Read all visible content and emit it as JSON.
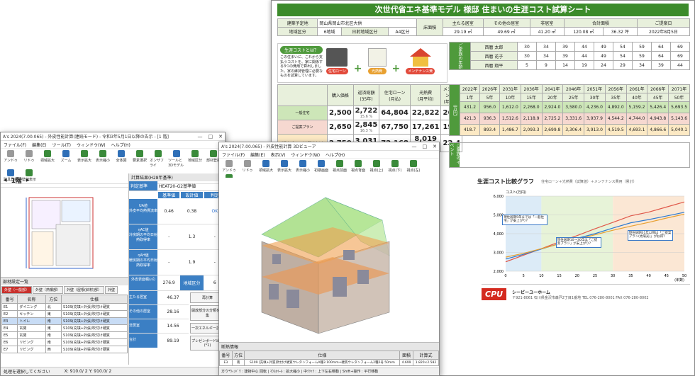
{
  "sheet": {
    "title": "次世代省エネ基準モデル 様邸 住まいの生涯コスト試算シート",
    "info": {
      "site_label": "建築予定地",
      "site": "岡山県岡山市北区大供",
      "region_label": "地域区分",
      "region": "6地域",
      "solar_label": "日射地域区分",
      "solar": "A4区分",
      "floor_label": "床面積",
      "main_label": "主たる居室",
      "main_val": "29.19 ㎡",
      "other_label": "その他の居室",
      "other_val": "49.69 ㎡",
      "nonlive_label": "非居室",
      "nonlive_val": "41.20 ㎡",
      "total_label": "合計面積",
      "total_val": "120.08 ㎡",
      "tsubo_val": "36.32 坪",
      "date_label": "ご提案日",
      "date": "2022年8月5日"
    },
    "what_title": "生涯コストとは？",
    "what_text": "この住まいに、これから支払うコストを、家に関係する3つの費用で算出しました。家の維持管理に必要なものを試算しています。",
    "cost_icons": [
      "住宅ローン",
      "光熱費",
      "メンテナンス費"
    ],
    "family_header": "ご家族の年齢",
    "family": [
      {
        "name": "西暦 太郎",
        "ages": [
          "30",
          "34",
          "39",
          "44",
          "49",
          "54",
          "59",
          "64",
          "69"
        ]
      },
      {
        "name": "西暦 花子",
        "ages": [
          "30",
          "34",
          "39",
          "44",
          "49",
          "54",
          "59",
          "64",
          "69"
        ]
      },
      {
        "name": "西暦 翔平",
        "ages": [
          "5",
          "9",
          "14",
          "19",
          "24",
          "29",
          "34",
          "39",
          "44"
        ]
      }
    ],
    "cost_headers": [
      "購入価格",
      "返済総額\n(35年)",
      "住宅ローン\n(月払)",
      "光熱費\n(月平均)",
      "メンテナンス費\n(年平均)"
    ],
    "rows": [
      {
        "name": "一般住宅",
        "price": "2,500",
        "repay": "2,722",
        "loan": "64,804",
        "energy": "22,822",
        "maint": "26.0",
        "ratio": "15.6 %"
      },
      {
        "name": "ご提案プラン",
        "price": "2,650",
        "repay": "2,845",
        "loan": "67,750",
        "energy": "17,261",
        "maint": "19.2",
        "ratio": "16.3 %"
      },
      {
        "name": "ご提案プラン（太陽光含む）",
        "price": "2,750",
        "repay": "3,031",
        "loan": "72,168",
        "energy": "8,019",
        "energy2": "10,216",
        "maint": "22.4",
        "ratio": "17.3 %"
      }
    ],
    "years": [
      "2022年",
      "2026年",
      "2031年",
      "2036年",
      "2041年",
      "2046年",
      "2051年",
      "2056年",
      "2061年",
      "2066年",
      "2071年"
    ],
    "year_nums": [
      "1年",
      "5年",
      "10年",
      "15年",
      "20年",
      "25年",
      "30年",
      "35年",
      "40年",
      "45年",
      "50年"
    ],
    "cum_label": "（万円）",
    "cum": [
      [
        "431.2",
        "956.0",
        "1,612.0",
        "2,268.0",
        "2,924.0",
        "3,580.0",
        "4,236.0",
        "4,892.0",
        "5,159.2",
        "5,426.4",
        "5,693.5"
      ],
      [
        "421.3",
        "936.3",
        "1,512.6",
        "2,118.9",
        "2,725.2",
        "3,331.6",
        "3,937.9",
        "4,544.2",
        "4,744.0",
        "4,943.8",
        "5,143.6"
      ],
      [
        "418.7",
        "893.4",
        "1,486.7",
        "2,093.3",
        "2,699.8",
        "3,306.4",
        "3,913.0",
        "4,519.5",
        "4,693.1",
        "4,866.6",
        "5,040.1"
      ]
    ],
    "event_label": "ご家族のイベント",
    "graph_title": "生涯コスト比較グラフ",
    "graph_note": "住宅ローン＋光熱費（試算値）＋メンテナンス費用（累計）",
    "ylabel": "コスト(万円)",
    "xlabel": "(年数)",
    "callouts": [
      "現住居期5年までは「一般住宅」が安上がり？",
      "現住居期10〜30年は「ご提案プラン」が安上がり？",
      "現住居期31年以降は「ご提案プラン(太陽光)」がお得？"
    ],
    "company": "シービーユーホーム",
    "company_addr": "〒921-8061 石川県金沢市森戸2丁目1番地 TEL 076-280-8001 FAX 076-280-8002"
  },
  "chart_data": {
    "type": "line",
    "title": "生涯コスト比較グラフ",
    "xlabel": "(年数)",
    "ylabel": "コスト(万円)",
    "x": [
      0,
      5,
      10,
      15,
      20,
      25,
      30,
      35,
      40,
      45,
      50
    ],
    "ylim": [
      2000,
      6000
    ],
    "xlim": [
      0,
      50
    ],
    "yticks": [
      "2,000",
      "3,000",
      "4,000",
      "5,000",
      "6,000"
    ],
    "xticks": [
      "0",
      "5",
      "10",
      "15",
      "20",
      "25",
      "30",
      "35",
      "40",
      "45",
      "50"
    ],
    "series": [
      {
        "color": "#e0584a",
        "values": [
          2500,
          2850,
          3200,
          3560,
          3900,
          4260,
          4600,
          4950,
          5150,
          5420,
          5690
        ]
      },
      {
        "color": "#2e7bd1",
        "values": [
          2650,
          2900,
          3180,
          3470,
          3750,
          4000,
          4300,
          4580,
          4750,
          4940,
          5140
        ]
      },
      {
        "color": "#e8a030",
        "values": [
          2750,
          2950,
          3200,
          3450,
          3690,
          3940,
          4180,
          4400,
          4600,
          4830,
          5040
        ]
      }
    ]
  },
  "left": {
    "title": "A's 2024(7.00.065) - 外皮性能計算(連続モード) - 令和3年5月1日以降の告示 - [1 階]",
    "menu": [
      "ファイル(F)",
      "編集(E)",
      "ツール(T)",
      "ウィンドウ(W)",
      "ヘルプ(H)"
    ],
    "tools": [
      "アンドゥ",
      "リドゥ",
      "領域拡大",
      "ズーム",
      "表示拡大",
      "表示縮小",
      "全体図",
      "要素選択",
      "オンザフライ",
      "ツールと3Dモデル",
      "地域区分",
      "部材登録",
      "建具登録",
      "壁線表示"
    ],
    "floor": "1階",
    "result_title": "計算結果(H28年基準)",
    "spec_label": "判定基準",
    "spec_val": "HEAT20-G2基準値",
    "cols": [
      "基準値",
      "設計値",
      "判定"
    ],
    "ua_label": "UA値\n外皮平均熱貫流率",
    "ua_std": "0.46",
    "ua_des": "0.38",
    "ua_ok": "OK",
    "nac_label": "ηAC値\n冷房期の平均日射熱取得率",
    "nac_std": "-",
    "nac_des": "1.3",
    "nac_ok": "-",
    "nah_label": "ηAH値\n暖房期の平均日射熱取得率",
    "nah_std": "-",
    "nah_des": "1.9",
    "nah_ok": "-",
    "area_label": "外皮表面積(㎡)",
    "area_val": "276.9",
    "region_label": "地域区分",
    "region_val": "6",
    "floor_area_label": "床面積(㎡)",
    "main_room": "主たる居室",
    "main_room_val": "46.37",
    "other_room": "その他の居室",
    "other_room_val": "28.16",
    "nonlive": "非居室",
    "nonlive_val": "14.56",
    "total": "合計",
    "total_val": "89.19",
    "buttons": [
      "再計算",
      "開放部分の分類を編集",
      "一次エネルギー計算",
      "プレゼンボード出力(*1)"
    ],
    "list_title": "部材設定一覧",
    "tabs": [
      "外壁（一般部）",
      "外壁（熱橋部）",
      "外壁（屋根(斜材)部）",
      "外壁"
    ],
    "list_cols": [
      "番号",
      "名称",
      "方位",
      "仕様"
    ],
    "list_rows": [
      [
        "E1",
        "ダイニング",
        "北",
        "S109(充填+外張)吹付け硬質"
      ],
      [
        "E2",
        "キッチン",
        "東",
        "S109(充填+外張)吹付け硬質"
      ],
      [
        "E3",
        "トイレ",
        "南",
        "S109(充填+外張)吹付け硬質"
      ],
      [
        "E4",
        "玄関",
        "東",
        "S109(充填+外張)吹付け硬質"
      ],
      [
        "E5",
        "玄関",
        "南",
        "S109(充填+外張)吹付け硬質"
      ],
      [
        "E6",
        "リビング",
        "南",
        "S109(充填+外張)吹付け硬質"
      ],
      [
        "E7",
        "リビング",
        "西",
        "S109(充填+外張)吹付け硬質"
      ]
    ],
    "status": "処理を選択してください",
    "coords": "X: 910.0/ 2   Y: 910.0/ 2"
  },
  "mid": {
    "title": "A's 2024(7.00.065) - 外皮性能計算 3Dビューア",
    "menu": [
      "ファイル(F)",
      "編集(E)",
      "表示(V)",
      "ウィンドウ(W)",
      "ヘルプ(H)"
    ],
    "tools": [
      "アンドゥ",
      "リドゥ",
      "領域拡大",
      "表示拡大",
      "表示縮小",
      "初期画面",
      "視点前面",
      "視点背面",
      "視点(上)",
      "視点(下)",
      "視点(左)",
      "視点(右)"
    ],
    "info_title": "断熱情報",
    "info_cols": [
      "番号",
      "方位",
      "仕様",
      "面積",
      "計算式"
    ],
    "info_row": [
      "E3",
      "南",
      "S109 [充填+外張]吹付け硬質ウレタンフォームA種3 100mm+硬質ウレタンフォーム2種2号 50mm",
      "4.699",
      "1.820×2.582"
    ],
    "status": "方ウ*ｳｨﾝﾄﾞｳ : 建物中心 回転 | ﾏｳｽﾎｲｰﾙ : 拡大縮小 | 中ｸﾘｯｸ : 上下左右移動 | Shift+操作 : 平行移動"
  }
}
